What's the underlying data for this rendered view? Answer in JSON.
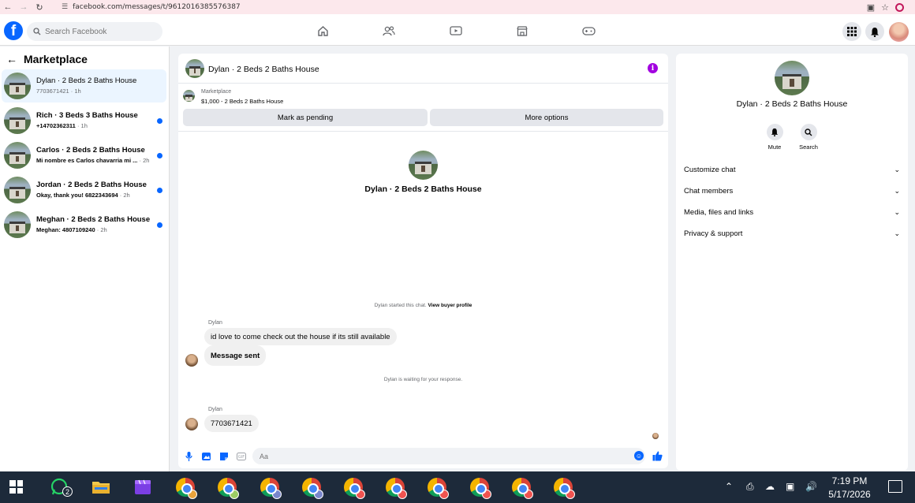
{
  "browser": {
    "url": "facebook.com/messages/t/9612016385576387"
  },
  "fb_nav": {
    "search_placeholder": "Search Facebook"
  },
  "left_panel": {
    "title": "Marketplace",
    "conversations": [
      {
        "name": "Dylan · 2 Beds 2 Baths House",
        "snippet": "7703671421",
        "time": "1h",
        "unread": false,
        "active": true
      },
      {
        "name": "Rich · 3 Beds 3 Baths House",
        "snippet": "+14702362311",
        "time": "1h",
        "unread": true,
        "active": false
      },
      {
        "name": "Carlos · 2 Beds 2 Baths House",
        "snippet": "Mi nombre es Carlos chavarria mi ...",
        "time": "2h",
        "unread": true,
        "active": false
      },
      {
        "name": "Jordan · 2 Beds 2 Baths House",
        "snippet": "Okay, thank you! 6822343694",
        "time": "2h",
        "unread": true,
        "active": false
      },
      {
        "name": "Meghan · 2 Beds 2 Baths House",
        "snippet": "Meghan: 4807109240",
        "time": "2h",
        "unread": true,
        "active": false
      }
    ]
  },
  "chat": {
    "header_title": "Dylan · 2 Beds 2 Baths House",
    "listing_source": "Marketplace",
    "listing_summary": "$1,000 - 2 Beds 2 Baths House",
    "mark_pending_label": "Mark as pending",
    "more_options_label": "More options",
    "intro_name": "Dylan · 2 Beds 2 Baths House",
    "started_text": "Dylan started this chat.",
    "view_profile_label": "View buyer profile",
    "messages": [
      {
        "sender": "Dylan",
        "text": "id love to come check out the house if its still available"
      },
      {
        "sender": "",
        "text": "Message sent"
      },
      {
        "sender": "Dylan",
        "text": "7703671421"
      }
    ],
    "waiting_text": "Dylan is waiting for your response.",
    "composer_placeholder": "Aa"
  },
  "right_panel": {
    "name": "Dylan · 2 Beds 2 Baths House",
    "mute_label": "Mute",
    "search_label": "Search",
    "sections": [
      "Customize chat",
      "Chat members",
      "Media, files and links",
      "Privacy & support"
    ]
  },
  "taskbar": {
    "whatsapp_badge": "2",
    "time": "7:19 PM",
    "date": "5/17/2026",
    "chrome_profile_colors": [
      "#e8a33c",
      "#9ccc65",
      "#7986cb",
      "#7986cb",
      "#ef5350",
      "#ef5350",
      "#ef5350",
      "#ef5350",
      "#ef5350",
      "#ef5350"
    ]
  },
  "colors": {
    "fb_blue": "#0866ff",
    "active_bg": "#ebf5ff",
    "info_purple": "#a200e0"
  }
}
